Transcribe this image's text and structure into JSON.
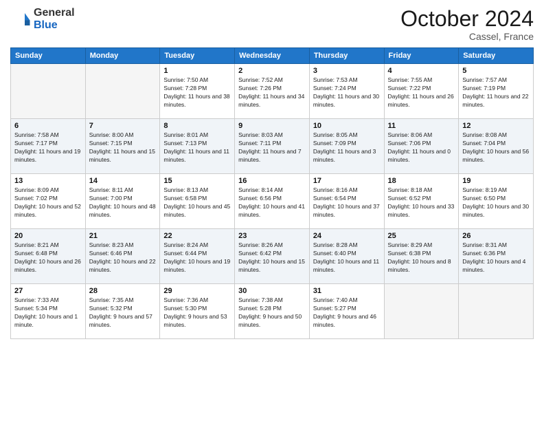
{
  "header": {
    "logo_general": "General",
    "logo_blue": "Blue",
    "month": "October 2024",
    "location": "Cassel, France"
  },
  "days_of_week": [
    "Sunday",
    "Monday",
    "Tuesday",
    "Wednesday",
    "Thursday",
    "Friday",
    "Saturday"
  ],
  "weeks": [
    [
      {
        "day": "",
        "info": ""
      },
      {
        "day": "",
        "info": ""
      },
      {
        "day": "1",
        "info": "Sunrise: 7:50 AM\nSunset: 7:28 PM\nDaylight: 11 hours and 38 minutes."
      },
      {
        "day": "2",
        "info": "Sunrise: 7:52 AM\nSunset: 7:26 PM\nDaylight: 11 hours and 34 minutes."
      },
      {
        "day": "3",
        "info": "Sunrise: 7:53 AM\nSunset: 7:24 PM\nDaylight: 11 hours and 30 minutes."
      },
      {
        "day": "4",
        "info": "Sunrise: 7:55 AM\nSunset: 7:22 PM\nDaylight: 11 hours and 26 minutes."
      },
      {
        "day": "5",
        "info": "Sunrise: 7:57 AM\nSunset: 7:19 PM\nDaylight: 11 hours and 22 minutes."
      }
    ],
    [
      {
        "day": "6",
        "info": "Sunrise: 7:58 AM\nSunset: 7:17 PM\nDaylight: 11 hours and 19 minutes."
      },
      {
        "day": "7",
        "info": "Sunrise: 8:00 AM\nSunset: 7:15 PM\nDaylight: 11 hours and 15 minutes."
      },
      {
        "day": "8",
        "info": "Sunrise: 8:01 AM\nSunset: 7:13 PM\nDaylight: 11 hours and 11 minutes."
      },
      {
        "day": "9",
        "info": "Sunrise: 8:03 AM\nSunset: 7:11 PM\nDaylight: 11 hours and 7 minutes."
      },
      {
        "day": "10",
        "info": "Sunrise: 8:05 AM\nSunset: 7:09 PM\nDaylight: 11 hours and 3 minutes."
      },
      {
        "day": "11",
        "info": "Sunrise: 8:06 AM\nSunset: 7:06 PM\nDaylight: 11 hours and 0 minutes."
      },
      {
        "day": "12",
        "info": "Sunrise: 8:08 AM\nSunset: 7:04 PM\nDaylight: 10 hours and 56 minutes."
      }
    ],
    [
      {
        "day": "13",
        "info": "Sunrise: 8:09 AM\nSunset: 7:02 PM\nDaylight: 10 hours and 52 minutes."
      },
      {
        "day": "14",
        "info": "Sunrise: 8:11 AM\nSunset: 7:00 PM\nDaylight: 10 hours and 48 minutes."
      },
      {
        "day": "15",
        "info": "Sunrise: 8:13 AM\nSunset: 6:58 PM\nDaylight: 10 hours and 45 minutes."
      },
      {
        "day": "16",
        "info": "Sunrise: 8:14 AM\nSunset: 6:56 PM\nDaylight: 10 hours and 41 minutes."
      },
      {
        "day": "17",
        "info": "Sunrise: 8:16 AM\nSunset: 6:54 PM\nDaylight: 10 hours and 37 minutes."
      },
      {
        "day": "18",
        "info": "Sunrise: 8:18 AM\nSunset: 6:52 PM\nDaylight: 10 hours and 33 minutes."
      },
      {
        "day": "19",
        "info": "Sunrise: 8:19 AM\nSunset: 6:50 PM\nDaylight: 10 hours and 30 minutes."
      }
    ],
    [
      {
        "day": "20",
        "info": "Sunrise: 8:21 AM\nSunset: 6:48 PM\nDaylight: 10 hours and 26 minutes."
      },
      {
        "day": "21",
        "info": "Sunrise: 8:23 AM\nSunset: 6:46 PM\nDaylight: 10 hours and 22 minutes."
      },
      {
        "day": "22",
        "info": "Sunrise: 8:24 AM\nSunset: 6:44 PM\nDaylight: 10 hours and 19 minutes."
      },
      {
        "day": "23",
        "info": "Sunrise: 8:26 AM\nSunset: 6:42 PM\nDaylight: 10 hours and 15 minutes."
      },
      {
        "day": "24",
        "info": "Sunrise: 8:28 AM\nSunset: 6:40 PM\nDaylight: 10 hours and 11 minutes."
      },
      {
        "day": "25",
        "info": "Sunrise: 8:29 AM\nSunset: 6:38 PM\nDaylight: 10 hours and 8 minutes."
      },
      {
        "day": "26",
        "info": "Sunrise: 8:31 AM\nSunset: 6:36 PM\nDaylight: 10 hours and 4 minutes."
      }
    ],
    [
      {
        "day": "27",
        "info": "Sunrise: 7:33 AM\nSunset: 5:34 PM\nDaylight: 10 hours and 1 minute."
      },
      {
        "day": "28",
        "info": "Sunrise: 7:35 AM\nSunset: 5:32 PM\nDaylight: 9 hours and 57 minutes."
      },
      {
        "day": "29",
        "info": "Sunrise: 7:36 AM\nSunset: 5:30 PM\nDaylight: 9 hours and 53 minutes."
      },
      {
        "day": "30",
        "info": "Sunrise: 7:38 AM\nSunset: 5:28 PM\nDaylight: 9 hours and 50 minutes."
      },
      {
        "day": "31",
        "info": "Sunrise: 7:40 AM\nSunset: 5:27 PM\nDaylight: 9 hours and 46 minutes."
      },
      {
        "day": "",
        "info": ""
      },
      {
        "day": "",
        "info": ""
      }
    ]
  ]
}
